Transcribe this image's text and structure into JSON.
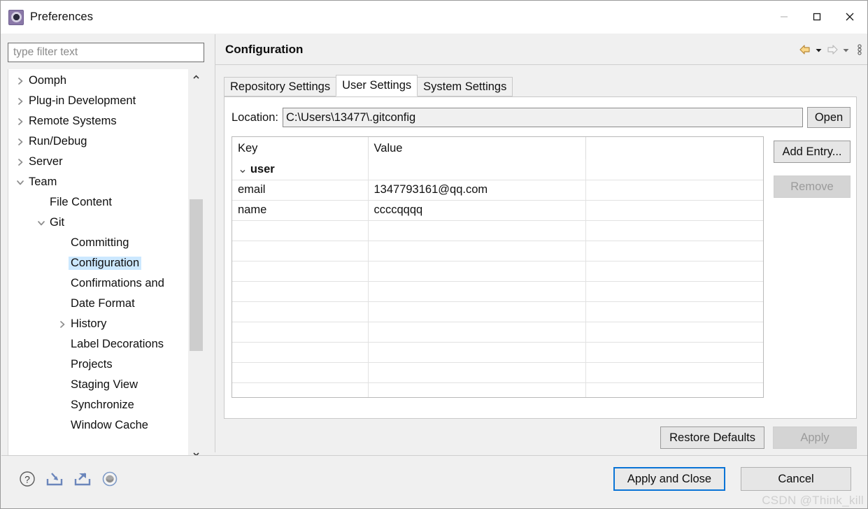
{
  "window": {
    "title": "Preferences",
    "icon": "preferences-gear-icon",
    "controls": {
      "minimize": "minimize-icon",
      "maximize": "maximize-icon",
      "close": "close-icon"
    }
  },
  "sidebar": {
    "filter_placeholder": "type filter text",
    "filter_value": "",
    "items": [
      {
        "label": "Oomph",
        "depth": 0,
        "twisty": "collapsed",
        "selected": false
      },
      {
        "label": "Plug-in Development",
        "depth": 0,
        "twisty": "collapsed",
        "selected": false
      },
      {
        "label": "Remote Systems",
        "depth": 0,
        "twisty": "collapsed",
        "selected": false
      },
      {
        "label": "Run/Debug",
        "depth": 0,
        "twisty": "collapsed",
        "selected": false
      },
      {
        "label": "Server",
        "depth": 0,
        "twisty": "collapsed",
        "selected": false
      },
      {
        "label": "Team",
        "depth": 0,
        "twisty": "expanded",
        "selected": false
      },
      {
        "label": "File Content",
        "depth": 1,
        "twisty": "none",
        "selected": false
      },
      {
        "label": "Git",
        "depth": 1,
        "twisty": "expanded",
        "selected": false
      },
      {
        "label": "Committing",
        "depth": 2,
        "twisty": "none",
        "selected": false
      },
      {
        "label": "Configuration",
        "depth": 2,
        "twisty": "none",
        "selected": true
      },
      {
        "label": "Confirmations and",
        "depth": 2,
        "twisty": "none",
        "selected": false
      },
      {
        "label": "Date Format",
        "depth": 2,
        "twisty": "none",
        "selected": false
      },
      {
        "label": "History",
        "depth": 2,
        "twisty": "collapsed",
        "selected": false
      },
      {
        "label": "Label Decorations",
        "depth": 2,
        "twisty": "none",
        "selected": false
      },
      {
        "label": "Projects",
        "depth": 2,
        "twisty": "none",
        "selected": false
      },
      {
        "label": "Staging View",
        "depth": 2,
        "twisty": "none",
        "selected": false
      },
      {
        "label": "Synchronize",
        "depth": 2,
        "twisty": "none",
        "selected": false
      },
      {
        "label": "Window Cache",
        "depth": 2,
        "twisty": "none",
        "selected": false
      }
    ]
  },
  "page": {
    "title": "Configuration",
    "toolbar": {
      "back": "back-arrow-icon",
      "back_menu": "back-dropdown-icon",
      "forward": "forward-arrow-icon",
      "forward_menu": "forward-dropdown-icon",
      "view_menu": "view-menu-icon"
    },
    "tabs": [
      {
        "label": "Repository Settings",
        "active": false
      },
      {
        "label": "User Settings",
        "active": true
      },
      {
        "label": "System Settings",
        "active": false
      }
    ],
    "location": {
      "label": "Location:",
      "value": "C:\\Users\\13477\\.gitconfig",
      "open_label": "Open"
    },
    "table": {
      "columns": [
        "Key",
        "Value",
        ""
      ],
      "rows": [
        {
          "type": "group",
          "key": "user",
          "value": "",
          "extra": "",
          "expanded": true
        },
        {
          "type": "entry",
          "key": "email",
          "value": "1347793161@qq.com",
          "extra": ""
        },
        {
          "type": "entry",
          "key": "name",
          "value": "ccccqqqq",
          "extra": ""
        }
      ],
      "empty_row_count": 11
    },
    "side_buttons": {
      "add_entry": {
        "label": "Add Entry...",
        "enabled": true
      },
      "remove": {
        "label": "Remove",
        "enabled": false
      }
    },
    "footer_buttons": {
      "restore_defaults": {
        "label": "Restore Defaults",
        "enabled": true
      },
      "apply": {
        "label": "Apply",
        "enabled": false
      }
    }
  },
  "dialog": {
    "icons": [
      "help-icon",
      "import-preferences-icon",
      "export-preferences-icon",
      "oomph-recorder-icon"
    ],
    "apply_and_close_label": "Apply and Close",
    "cancel_label": "Cancel"
  },
  "watermark": "CSDN @Think_kill",
  "colors": {
    "selection": "#cce8ff",
    "focus_border": "#0a74d6",
    "title_icon": "#8a78a8",
    "chrome": "#f0f0f0"
  }
}
